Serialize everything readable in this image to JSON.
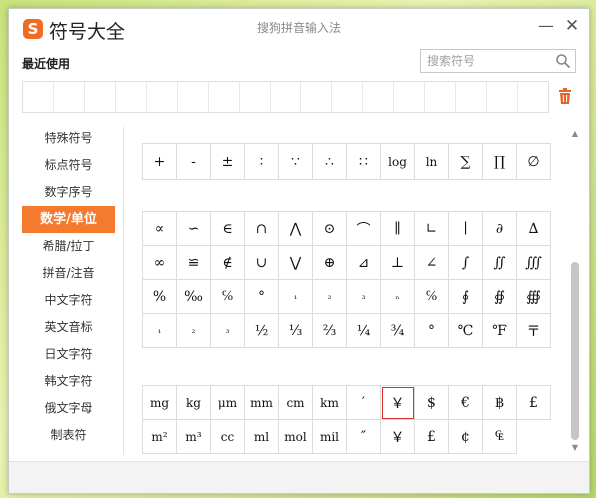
{
  "window": {
    "app_title": "符号大全",
    "ime_title": "搜狗拼音输入法",
    "logo_glyph": "S",
    "minimize_glyph": "—",
    "close_glyph": "✕"
  },
  "recent": {
    "label": "最近使用",
    "slot_count": 17
  },
  "search": {
    "placeholder": "搜索符号"
  },
  "sidebar": {
    "items": [
      {
        "label": "特殊符号"
      },
      {
        "label": "标点符号"
      },
      {
        "label": "数字序号"
      },
      {
        "label": "数学/单位",
        "active": true
      },
      {
        "label": "希腊/拉丁"
      },
      {
        "label": "拼音/注音"
      },
      {
        "label": "中文字符"
      },
      {
        "label": "英文音标"
      },
      {
        "label": "日文字符"
      },
      {
        "label": "韩文字符"
      },
      {
        "label": "俄文字母"
      },
      {
        "label": "制表符"
      }
    ]
  },
  "symbols": {
    "group1": [
      "+",
      "-",
      "±",
      "∶",
      "∵",
      "∴",
      "∷",
      "log",
      "ln",
      "∑",
      "∏",
      "∅"
    ],
    "group2": [
      "∝",
      "∽",
      "∈",
      "∩",
      "⋀",
      "⊙",
      "⌒",
      "∥",
      "∟",
      "∣",
      "∂",
      "∆",
      "∞",
      "≌",
      "∉",
      "∪",
      "⋁",
      "⊕",
      "⊿",
      "⊥",
      "∠",
      "∫",
      "∬",
      "∭",
      "%",
      "‰",
      "℅",
      "°",
      "₁",
      "₂",
      "₃",
      "ₙ",
      "℅",
      "∮",
      "∯",
      "∰",
      "₁",
      "₂",
      "₃",
      "½",
      "⅓",
      "⅔",
      "¼",
      "¾",
      "°",
      "℃",
      "℉",
      "〒"
    ],
    "group3": [
      "mg",
      "kg",
      "μm",
      "mm",
      "cm",
      "km",
      "′",
      "￥",
      "$",
      "€",
      "฿",
      "£",
      "m²",
      "m³",
      "cc",
      "ml",
      "mol",
      "mil",
      "″",
      "￥",
      "£",
      "¢",
      "₠"
    ],
    "selected": "￥"
  },
  "colors": {
    "accent": "#f47a2d",
    "logo": "#f26a23",
    "trash": "#e2652c",
    "selected_border": "#d9302f"
  }
}
